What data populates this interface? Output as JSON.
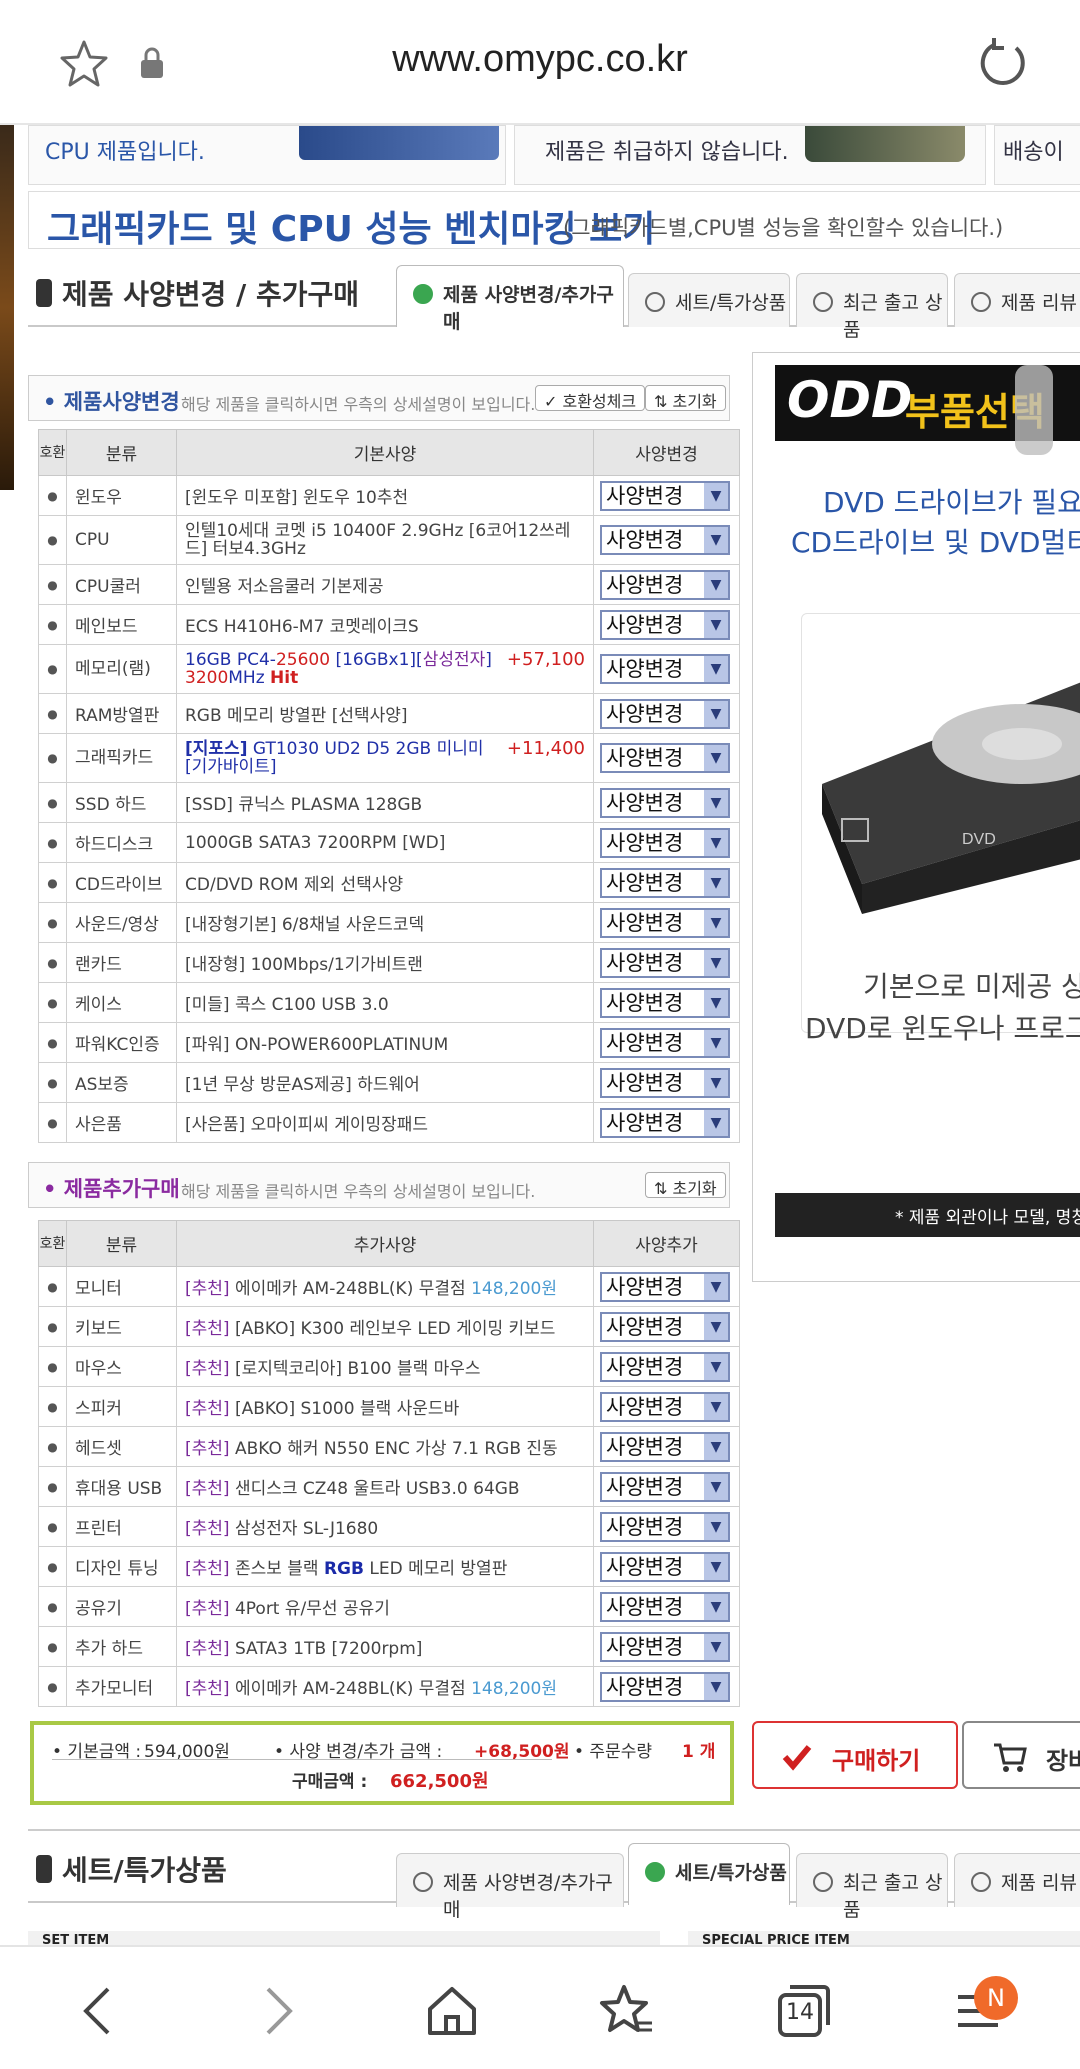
{
  "browser": {
    "url": "www.omypc.co.kr",
    "tab_count": "14",
    "badge": "N"
  },
  "banners": {
    "left_text": "CPU 제품입니다.",
    "mid_text": "제품은 취급하지 않습니다.",
    "right_text": "배송이"
  },
  "bench": {
    "title": "그래픽카드 및 CPU 성능 벤치마킹 보기",
    "sub": "(그래픽카드별,CPU별 성능을 확인할수 있습니다.)"
  },
  "section1": {
    "title": "제품 사양변경 / 추가구매",
    "tabs": [
      "제품 사양변경/추가구매",
      "세트/특가상품",
      "최근 출고 상품",
      "제품 리뷰"
    ]
  },
  "spec_change": {
    "title": "• 제품사양변경",
    "desc": "해당 제품을 클릭하시면 우측의 상세설명이 보입니다.",
    "compat_btn": "✓ 호환성체크",
    "reset_btn": "⇅ 초기화",
    "headers": [
      "호환",
      "분류",
      "기본사양",
      "사양변경"
    ],
    "rows": [
      {
        "cat": "윈도우",
        "spec": "[윈도우 미포함] 윈도우 10추천"
      },
      {
        "cat": "CPU",
        "spec": "인텔10세대 코멧 i5 10400F 2.9GHz [6코어12쓰레드] 터보4.3GHz"
      },
      {
        "cat": "CPU쿨러",
        "spec": "인텔용 저소음쿨러 기본제공"
      },
      {
        "cat": "메인보드",
        "spec": "ECS H410H6-M7 코멧레이크S"
      },
      {
        "cat": "메모리(램)",
        "spec_a": "16GB PC4-",
        "spec_b": "25600",
        "spec_c": " [16GBx1][",
        "spec_d": "삼성전자",
        "spec_e": "]",
        "spec_f": "3200",
        "spec_g": "MHz ",
        "spec_h": "Hit",
        "price": "+57,100"
      },
      {
        "cat": "RAM방열판",
        "spec": "RGB 메모리 방열판 [선택사양]"
      },
      {
        "cat": "그래픽카드",
        "spec_a": "[지포스]",
        "spec_b": " GT1030 UD2 D5 2GB 미니미 [기가바이트]",
        "price": "+11,400"
      },
      {
        "cat": "SSD 하드",
        "spec": "[SSD] 큐닉스 PLASMA 128GB"
      },
      {
        "cat": "하드디스크",
        "spec": "1000GB SATA3 7200RPM [WD]"
      },
      {
        "cat": "CD드라이브",
        "spec": "CD/DVD ROM 제외 선택사양"
      },
      {
        "cat": "사운드/영상",
        "spec": "[내장형기본] 6/8채널 사운드코덱"
      },
      {
        "cat": "랜카드",
        "spec": "[내장형] 100Mbps/1기가비트랜"
      },
      {
        "cat": "케이스",
        "spec": "[미들] 콕스 C100 USB 3.0"
      },
      {
        "cat": "파워KC인증",
        "spec": "[파워] ON-POWER600PLATINUM"
      },
      {
        "cat": "AS보증",
        "spec": "[1년 무상 방문AS제공] 하드웨어"
      },
      {
        "cat": "사은품",
        "spec": "[사은품] 오마이피씨 게이밍장패드"
      }
    ],
    "select_label": "사양변경"
  },
  "add_buy": {
    "title": "• 제품추가구매",
    "desc": "해당 제품을 클릭하시면 우측의 상세설명이 보입니다.",
    "reset_btn": "⇅ 초기화",
    "headers": [
      "호환",
      "분류",
      "추가사양",
      "사양추가"
    ],
    "tag": "[추천]",
    "rows": [
      {
        "cat": "모니터",
        "spec": " 에이메카 AM-248BL(K) 무결점 ",
        "price": "148,200원"
      },
      {
        "cat": "키보드",
        "spec": " [ABKO] K300 레인보우 LED 게이밍 키보드"
      },
      {
        "cat": "마우스",
        "spec": " [로지텍코리아] B100 블랙 마우스"
      },
      {
        "cat": "스피커",
        "spec": " [ABKO] S1000 블랙 사운드바"
      },
      {
        "cat": "헤드셋",
        "spec": " ABKO 해커 N550 ENC 가상 7.1 RGB 진동"
      },
      {
        "cat": "휴대용 USB",
        "spec": " 샌디스크 CZ48 울트라 USB3.0 64GB"
      },
      {
        "cat": "프린터",
        "spec": " 삼성전자 SL-J1680"
      },
      {
        "cat": "디자인 튜닝",
        "spec_a": " 존스보 블랙 ",
        "spec_b": "RGB",
        "spec_c": " LED 메모리 방열판"
      },
      {
        "cat": "공유기",
        "spec": " 4Port 유/무선 공유기"
      },
      {
        "cat": "추가 하드",
        "spec": " SATA3 1TB [7200rpm]"
      },
      {
        "cat": "추가모니터",
        "spec": " 에이메카 AM-248BL(K) 무결점 ",
        "price": "148,200원"
      }
    ]
  },
  "right_panel": {
    "odd": "ODD",
    "odd_sub": "부품선택",
    "line1": "DVD 드라이브가 필요 하",
    "line2": "CD드라이브 및 DVD멀티",
    "line3": "기본으로 미제공 상",
    "line4": "DVD로 윈도우나 프로그",
    "foot": "* 제품 외관이나 모델, 명칭은"
  },
  "totals": {
    "base_label": "• 기본금액 : ",
    "base_value": "594,000원",
    "change_label": "• 사양 변경/추가 금액 :",
    "change_value": "+68,500원",
    "qty_label": "• 주문수량",
    "qty_value": "1 개",
    "order_label": "구매금액 : ",
    "order_value": "662,500원"
  },
  "buttons": {
    "buy": "구매하기",
    "cart": "장바"
  },
  "section2": {
    "title": "세트/특가상품",
    "tabs": [
      "제품 사양변경/추가구매",
      "세트/특가상품",
      "최근 출고 상품",
      "제품 리뷰"
    ],
    "set_item": "SET ITEM",
    "special_item": "SPECIAL PRICE ITEM"
  }
}
